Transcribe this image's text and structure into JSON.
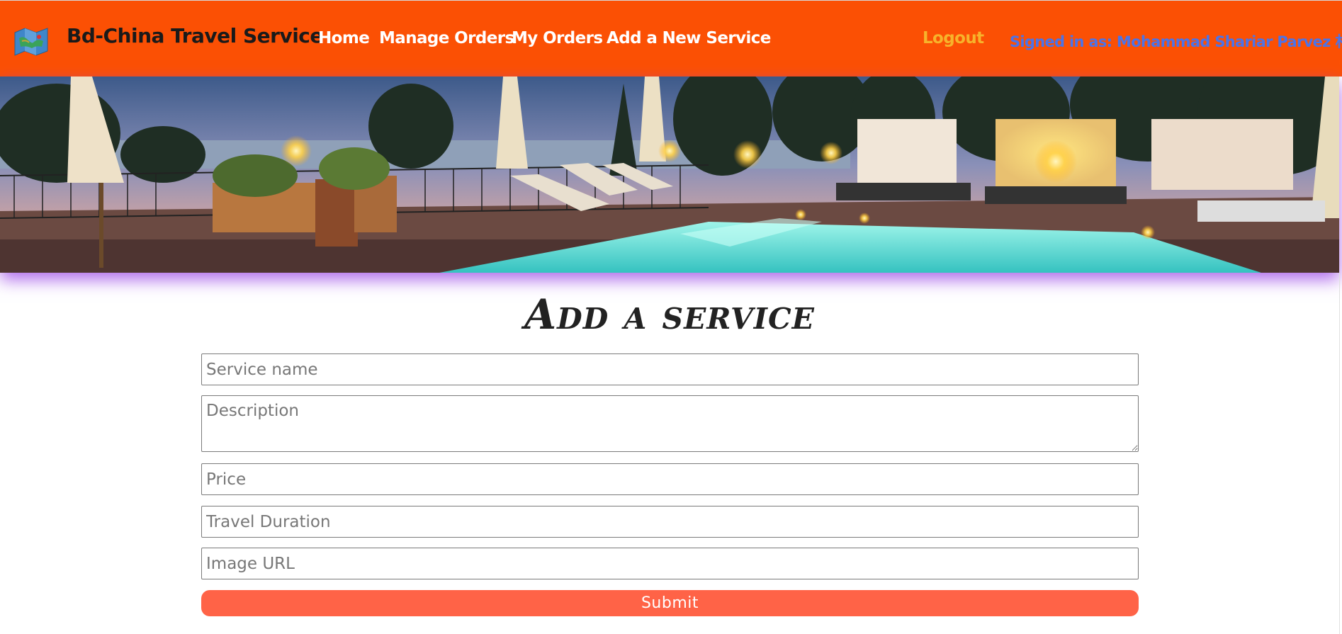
{
  "navbar": {
    "brand": "Bd-China Travel Service",
    "logo_icon": "folded-map-icon",
    "links": [
      "Home",
      "Manage Orders",
      "My Orders",
      "Add a New Service"
    ],
    "logout": "Logout",
    "signed_in": "Signed in as: Mohammad Shariar Parvez 朴维",
    "colors": {
      "bg": "#fb5004",
      "logout": "#f7b32b",
      "signed_in": "#4b73e8"
    }
  },
  "banner": {
    "image": "resort-pool-at-dusk"
  },
  "form": {
    "title": "Add a service",
    "placeholders": {
      "name": "Service name",
      "description": "Description",
      "price": "Price",
      "duration": "Travel Duration",
      "image": "Image URL"
    },
    "submit": "Submit",
    "colors": {
      "submit_bg": "#ff6347"
    }
  }
}
